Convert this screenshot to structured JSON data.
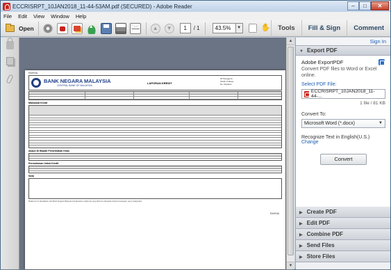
{
  "window": {
    "title": "ECCRISRPT_10JAN2018_11-44-53AM.pdf (SECURED) - Adobe Reader",
    "minimize": "–",
    "maximize": "□",
    "close": "✕"
  },
  "menu": [
    "File",
    "Edit",
    "View",
    "Window",
    "Help"
  ],
  "toolbar": {
    "open_label": "Open",
    "page_current": "1",
    "page_total": "/ 1",
    "zoom": "43.5%",
    "tabs": [
      "Tools",
      "Fill & Sign",
      "Comment"
    ]
  },
  "document": {
    "rahsia_top": "RAHSIA",
    "bank_name": "BANK NEGARA MALAYSIA",
    "bank_sub": "CENTRAL BANK OF MALAYSIA",
    "report_title": "LAPORAN KREDIT",
    "ref_lines": [
      "ID Pengguna",
      "Tarikh & Masa",
      "No. Rujukan"
    ],
    "section_1": "Maklumat Kredit",
    "section_2": "Akaun Di Bawah Pemerhatian Khas",
    "section_3": "Permohonan Untuk Kredit",
    "section_4": "Nota",
    "footer_right": "RAHSIA",
    "disclaimer": "Maklumat ini disediakan oleh Bank Negara Malaysia berdasarkan maklumat yang diterima daripada institusi kewangan yang melaporkan."
  },
  "right_pane": {
    "sign_in": "Sign In",
    "section_export": "Export PDF",
    "export_title": "Adobe ExportPDF",
    "export_desc": "Convert PDF files to Word or Excel online.",
    "select_file_label": "Select PDF File:",
    "file_name": "ECCRISRPT_10JAN2018_11-44-...",
    "file_info": "1 file / 81 KB",
    "convert_to_label": "Convert To:",
    "convert_to_value": "Microsoft Word (*.docx)",
    "recognize_text": "Recognize Text in English(U.S.)",
    "change_link": "Change",
    "convert_button": "Convert",
    "collapsed_sections": [
      "Create PDF",
      "Edit PDF",
      "Combine PDF",
      "Send Files",
      "Store Files"
    ]
  }
}
